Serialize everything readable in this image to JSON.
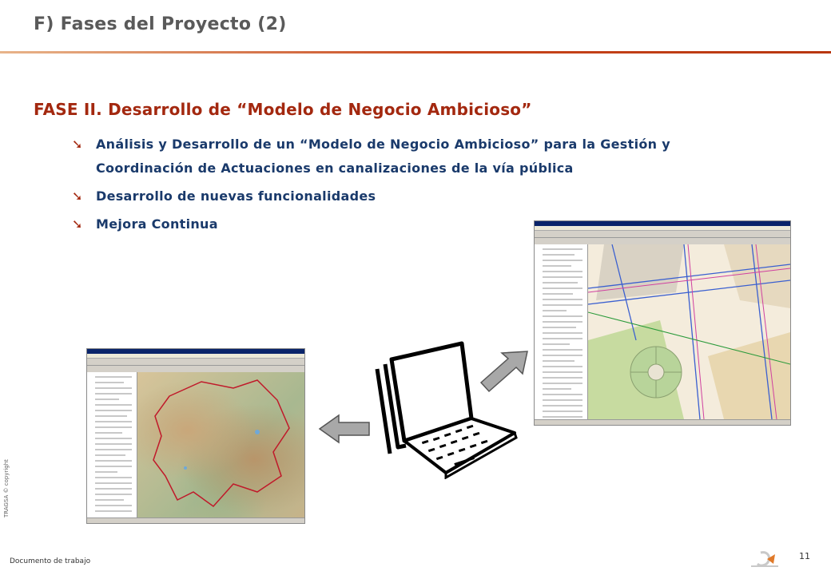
{
  "slide": {
    "title": "F) Fases del Proyecto (2)",
    "heading": "FASE II. Desarrollo de “Modelo de Negocio Ambicioso”",
    "bullet_glyph": "➘",
    "bullets": [
      "Análisis y Desarrollo de un “Modelo de Negocio Ambicioso” para la Gestión y Coordinación de Actuaciones en canalizaciones de la vía pública",
      "Desarrollo de nuevas funcionalidades",
      "Mejora Continua"
    ]
  },
  "footer": {
    "document_label": "Documento de trabajo",
    "copyright": "TRAGSA © copyright",
    "page_number": "11",
    "logo_text": "TRAGSA"
  },
  "colors": {
    "title": "#5a5a5a",
    "accent": "#a3280f",
    "bullet_text": "#1a3a6b",
    "rule": "#c8461c"
  },
  "icons": [
    "bullet-arrow-icon",
    "laptop-icon",
    "arrow-left-icon",
    "arrow-up-right-icon",
    "company-logo-icon"
  ]
}
